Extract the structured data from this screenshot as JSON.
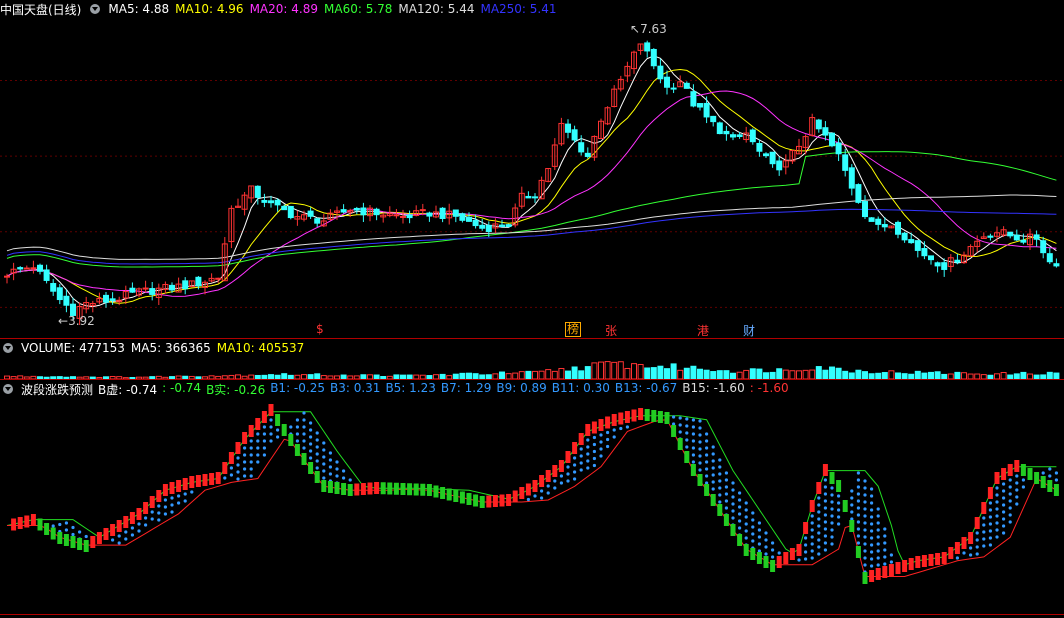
{
  "price_panel": {
    "title": "中国天盘(日线)",
    "indicators": [
      {
        "label": "MA5: 4.88",
        "color": "#ffffff"
      },
      {
        "label": "MA10: 4.96",
        "color": "#ffff00"
      },
      {
        "label": "MA20: 4.89",
        "color": "#ff33ff"
      },
      {
        "label": "MA60: 5.78",
        "color": "#33ff33"
      },
      {
        "label": "MA120: 5.44",
        "color": "#dddddd"
      },
      {
        "label": "MA250: 5.41",
        "color": "#3333ff"
      }
    ],
    "high_label": "7.63",
    "low_label": "3.92",
    "markers": [
      {
        "text": "$",
        "color": "#ff3333"
      },
      {
        "text": "榜",
        "color": "#ffaa00",
        "boxed": true
      },
      {
        "text": "张",
        "color": "#ff3333"
      },
      {
        "text": "港",
        "color": "#ff3333"
      },
      {
        "text": "财",
        "color": "#66aaff"
      }
    ]
  },
  "volume_panel": {
    "indicators": [
      {
        "label": "VOLUME: 477153",
        "color": "#ffffff"
      },
      {
        "label": "MA5: 366365",
        "color": "#ffffff"
      },
      {
        "label": "MA10: 405537",
        "color": "#ffff00"
      }
    ]
  },
  "wave_panel": {
    "indicators": [
      {
        "label": "波段涨跌预测",
        "color": "#ffffff"
      },
      {
        "label": "B虚: -0.74",
        "color": "#ffffff"
      },
      {
        "label": ": -0.74",
        "color": "#33ff33"
      },
      {
        "label": "B实: -0.26",
        "color": "#33ff33"
      },
      {
        "label": "B1: -0.25",
        "color": "#3399ff"
      },
      {
        "label": "B3: 0.31",
        "color": "#3399ff"
      },
      {
        "label": "B5: 1.23",
        "color": "#3399ff"
      },
      {
        "label": "B7: 1.29",
        "color": "#3399ff"
      },
      {
        "label": "B9: 0.89",
        "color": "#3399ff"
      },
      {
        "label": "B11: 0.30",
        "color": "#3399ff"
      },
      {
        "label": "B13: -0.67",
        "color": "#3399ff"
      },
      {
        "label": "B15: -1.60",
        "color": "#dddddd"
      },
      {
        "label": ": -1.60",
        "color": "#ff3333"
      }
    ]
  },
  "colors": {
    "up": "#ff3333",
    "down": "#33ffff",
    "wave_up": "#ff2222",
    "wave_down": "#22cc22",
    "dots": "#3399ff",
    "separator": "#b00000"
  },
  "chart_data": [
    {
      "type": "candlestick",
      "panel": "price",
      "x": "trading days (0-159)",
      "ylim": [
        3.7,
        7.8
      ],
      "close_path": [
        [
          0,
          4.45
        ],
        [
          4,
          4.55
        ],
        [
          8,
          4.1
        ],
        [
          10,
          3.95
        ],
        [
          12,
          4.05
        ],
        [
          16,
          4.1
        ],
        [
          20,
          4.2
        ],
        [
          24,
          4.25
        ],
        [
          28,
          4.3
        ],
        [
          32,
          4.4
        ],
        [
          34,
          5.3
        ],
        [
          37,
          5.55
        ],
        [
          40,
          5.35
        ],
        [
          44,
          5.2
        ],
        [
          48,
          5.15
        ],
        [
          52,
          5.3
        ],
        [
          56,
          5.25
        ],
        [
          60,
          5.2
        ],
        [
          64,
          5.25
        ],
        [
          68,
          5.2
        ],
        [
          72,
          5.05
        ],
        [
          76,
          5.1
        ],
        [
          78,
          5.45
        ],
        [
          80,
          5.5
        ],
        [
          82,
          5.85
        ],
        [
          84,
          6.4
        ],
        [
          86,
          6.2
        ],
        [
          88,
          6.0
        ],
        [
          90,
          6.5
        ],
        [
          93,
          7.0
        ],
        [
          96,
          7.5
        ],
        [
          98,
          7.2
        ],
        [
          100,
          6.9
        ],
        [
          102,
          7.0
        ],
        [
          104,
          6.7
        ],
        [
          106,
          6.5
        ],
        [
          110,
          6.2
        ],
        [
          112,
          6.3
        ],
        [
          114,
          6.05
        ],
        [
          116,
          5.85
        ],
        [
          118,
          5.9
        ],
        [
          120,
          6.15
        ],
        [
          122,
          6.45
        ],
        [
          124,
          6.25
        ],
        [
          126,
          6.0
        ],
        [
          128,
          5.6
        ],
        [
          130,
          5.25
        ],
        [
          132,
          5.05
        ],
        [
          134,
          5.1
        ],
        [
          136,
          4.95
        ],
        [
          138,
          4.75
        ],
        [
          140,
          4.65
        ],
        [
          142,
          4.55
        ],
        [
          144,
          4.65
        ],
        [
          146,
          4.8
        ],
        [
          148,
          4.95
        ],
        [
          150,
          5.0
        ],
        [
          152,
          4.95
        ],
        [
          154,
          4.9
        ],
        [
          156,
          4.92
        ],
        [
          158,
          4.6
        ]
      ]
    },
    {
      "type": "bar",
      "panel": "volume",
      "values_note": "relative volume 0-1",
      "volume_path": [
        [
          0,
          0.15
        ],
        [
          20,
          0.1
        ],
        [
          34,
          0.2
        ],
        [
          40,
          0.25
        ],
        [
          60,
          0.18
        ],
        [
          80,
          0.35
        ],
        [
          86,
          0.6
        ],
        [
          92,
          0.85
        ],
        [
          98,
          0.7
        ],
        [
          104,
          0.6
        ],
        [
          110,
          0.45
        ],
        [
          118,
          0.5
        ],
        [
          122,
          0.7
        ],
        [
          128,
          0.45
        ],
        [
          136,
          0.35
        ],
        [
          150,
          0.28
        ],
        [
          159,
          0.3
        ]
      ]
    },
    {
      "type": "line",
      "panel": "wave",
      "ylim": [
        -2.5,
        2.5
      ],
      "wave_path": [
        [
          0,
          -0.6
        ],
        [
          4,
          -0.45
        ],
        [
          8,
          -0.9
        ],
        [
          12,
          -1.1
        ],
        [
          16,
          -0.7
        ],
        [
          20,
          -0.3
        ],
        [
          24,
          0.3
        ],
        [
          28,
          0.5
        ],
        [
          32,
          0.6
        ],
        [
          36,
          1.6
        ],
        [
          40,
          2.3
        ],
        [
          44,
          1.3
        ],
        [
          48,
          0.4
        ],
        [
          52,
          0.3
        ],
        [
          56,
          0.35
        ],
        [
          64,
          0.3
        ],
        [
          72,
          0.0
        ],
        [
          76,
          0.05
        ],
        [
          80,
          0.4
        ],
        [
          84,
          0.9
        ],
        [
          88,
          1.8
        ],
        [
          92,
          2.05
        ],
        [
          96,
          2.2
        ],
        [
          100,
          2.1
        ],
        [
          104,
          0.8
        ],
        [
          108,
          -0.2
        ],
        [
          112,
          -1.2
        ],
        [
          116,
          -1.6
        ],
        [
          120,
          -1.2
        ],
        [
          122,
          -0.1
        ],
        [
          124,
          0.8
        ],
        [
          126,
          0.4
        ],
        [
          128,
          -0.6
        ],
        [
          130,
          -1.9
        ],
        [
          134,
          -1.7
        ],
        [
          138,
          -1.5
        ],
        [
          142,
          -1.4
        ],
        [
          146,
          -0.9
        ],
        [
          150,
          0.6
        ],
        [
          153,
          0.9
        ],
        [
          156,
          0.6
        ],
        [
          159,
          0.3
        ]
      ]
    }
  ]
}
